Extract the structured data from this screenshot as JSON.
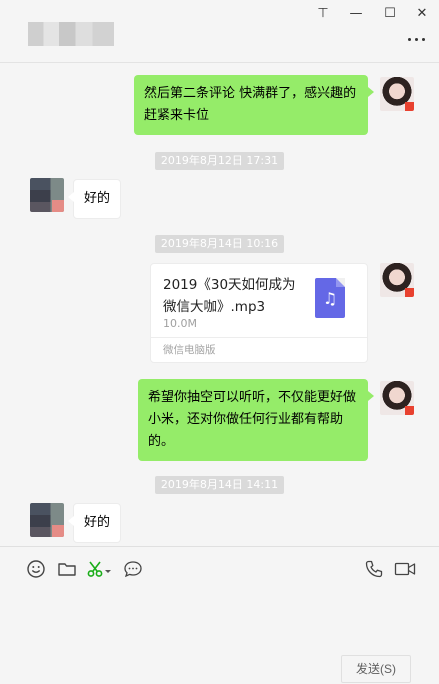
{
  "window": {
    "contact_name": "▇▇▇▇",
    "pin_glyph": "⊤",
    "minimize_glyph": "—",
    "maximize_glyph": "☐",
    "close_glyph": "✕"
  },
  "messages": [
    {
      "type": "text",
      "from": "self",
      "text": "然后第二条评论 快满群了，感兴趣的赶紧来卡位"
    },
    {
      "type": "timestamp",
      "text": "2019年8月12日 17:31"
    },
    {
      "type": "text",
      "from": "other",
      "text": "好的"
    },
    {
      "type": "timestamp",
      "text": "2019年8月14日 10:16"
    },
    {
      "type": "file",
      "from": "self",
      "file_name": "2019《30天如何成为微信大咖》.mp3",
      "file_size": "10.0M",
      "source": "微信电脑版",
      "icon": "music-note-icon"
    },
    {
      "type": "text",
      "from": "self",
      "text": "希望你抽空可以听听，不仅能更好做小米，还对你做任何行业都有帮助的。"
    },
    {
      "type": "timestamp",
      "text": "2019年8月14日 14:11"
    },
    {
      "type": "text",
      "from": "other",
      "text": "好的"
    }
  ],
  "toolbar": {
    "left_icons": [
      "emoji-icon",
      "folder-icon",
      "scissors-icon",
      "chat-bubble-icon"
    ],
    "right_icons": [
      "phone-icon",
      "video-icon"
    ]
  },
  "send_button": "发送(S)",
  "colors": {
    "self_bubble": "#95ec69",
    "other_bubble": "#ffffff",
    "background": "#f5f5f5",
    "scissors": "#1aad19"
  }
}
